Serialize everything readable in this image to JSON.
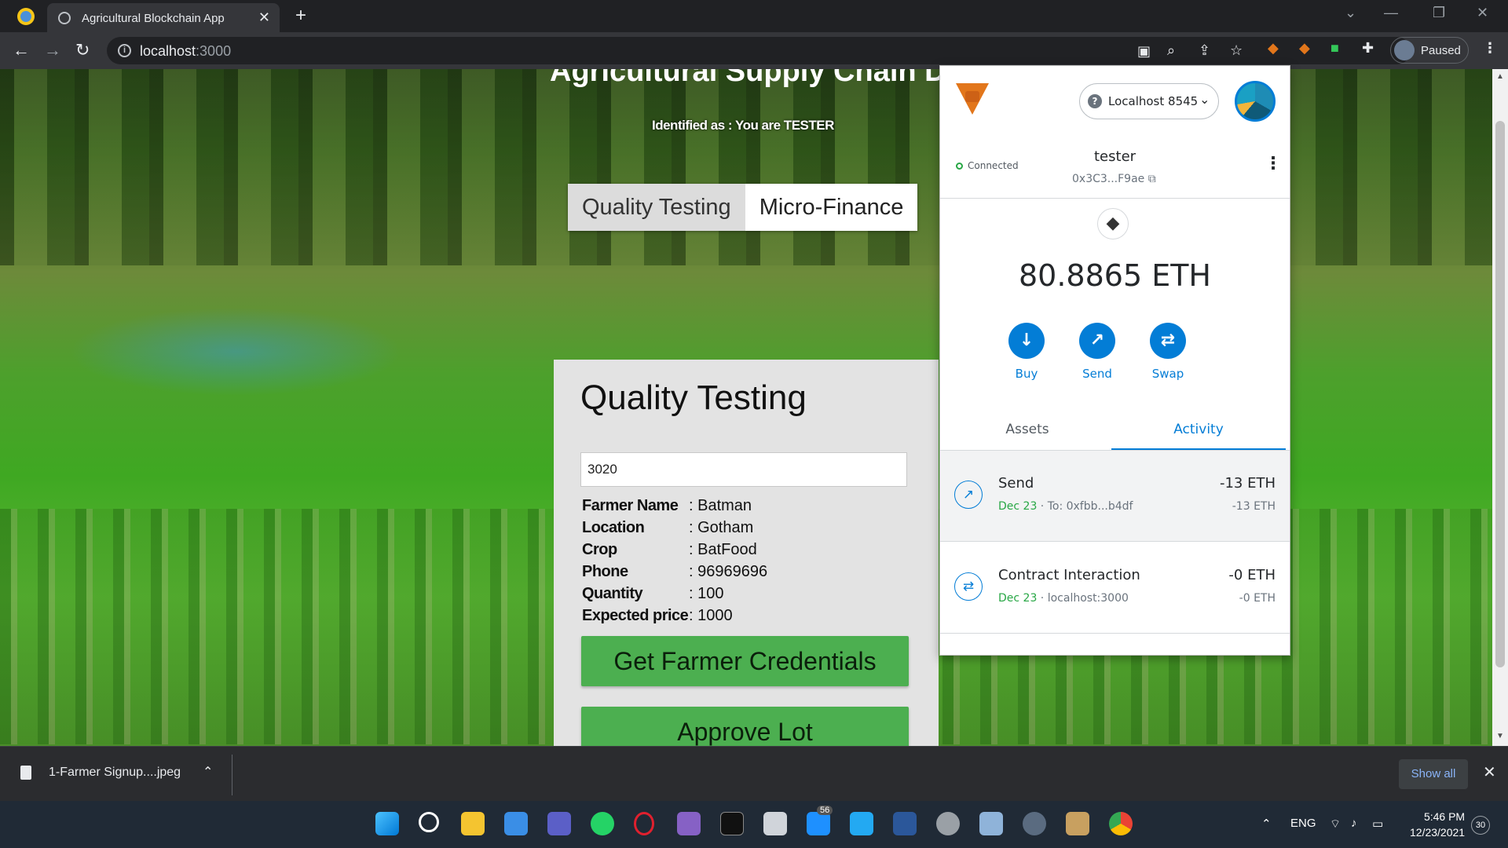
{
  "browser": {
    "tab_title": "Agricultural Blockchain App",
    "tab_close": "✕",
    "new_tab": "+",
    "url_host": "localhost",
    "url_port": ":3000",
    "profile_label": "Paused",
    "controls": {
      "minimize": "—",
      "restore": "❐",
      "close": "✕",
      "chevron": "⌄"
    }
  },
  "page": {
    "app_title": "Agricultural Supply Chain Dapp",
    "identified": "Identified as : You are TESTER",
    "tabs": [
      "Quality Testing",
      "Micro-Finance"
    ],
    "card": {
      "title": "Quality Testing",
      "input_value": "3020",
      "fields": [
        {
          "label": "Farmer Name",
          "value": ": Batman"
        },
        {
          "label": "Location",
          "value": ": Gotham"
        },
        {
          "label": "Crop",
          "value": ": BatFood"
        },
        {
          "label": "Phone",
          "value": ": 96969696"
        },
        {
          "label": "Quantity",
          "value": ": 100"
        },
        {
          "label": "Expected price",
          "value": ": 1000"
        }
      ],
      "get_credentials_label": "Get Farmer Credentials",
      "approve_label": "Approve Lot"
    }
  },
  "metamask": {
    "network": "Localhost 8545",
    "connected": "Connected",
    "account_name": "tester",
    "account_address": "0x3C3...F9ae",
    "balance": "80.8865 ETH",
    "actions": [
      "Buy",
      "Send",
      "Swap"
    ],
    "tabs": [
      "Assets",
      "Activity"
    ],
    "transactions": [
      {
        "title": "Send",
        "date": "Dec 23",
        "detail": " · To: 0xfbb...b4df",
        "amount": "-13 ETH",
        "amount2": "-13 ETH"
      },
      {
        "title": "Contract Interaction",
        "date": "Dec 23",
        "detail": " · localhost:3000",
        "amount": "-0 ETH",
        "amount2": "-0 ETH"
      }
    ]
  },
  "downloads": {
    "file_name": "1-Farmer Signup....jpeg",
    "show_all": "Show all"
  },
  "taskbar": {
    "language": "ENG",
    "time": "5:46 PM",
    "date": "12/23/2021",
    "notifications": "30",
    "badge": "56"
  }
}
